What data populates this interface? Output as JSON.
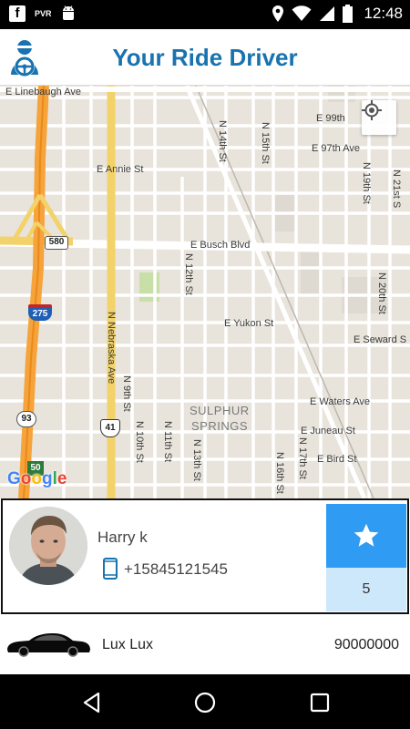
{
  "status_bar": {
    "left_icons": [
      "facebook-icon",
      "pvr-icon",
      "android-icon"
    ],
    "pvr_label": "PVR",
    "right_icons": [
      "location-icon",
      "wifi-icon",
      "signal-icon",
      "battery-icon"
    ],
    "time": "12:48"
  },
  "app_bar": {
    "title": "Your Ride Driver",
    "logo_icon": "driver-steering-wheel-icon",
    "brand_color": "#1873b0"
  },
  "map": {
    "labels": {
      "linebaugh": "E Linebaugh Ave",
      "e99": "E 99th",
      "e97": "E 97th Ave",
      "annie": "E Annie St",
      "busch": "E Busch Blvd",
      "yukon": "E Yukon St",
      "seward": "E Seward S",
      "waters": "E Waters Ave",
      "juneau": "E Juneau St",
      "bird": "E Bird St",
      "sulphur": "SULPHUR",
      "springs": "SPRINGS",
      "n14": "N 14th St",
      "n15": "N 15th St",
      "n19": "N 19th St",
      "n21": "N 21st S",
      "n12": "N 12th St",
      "n20": "N 20th St",
      "nebraska": "N Nebraska Ave",
      "n9": "N 9th St",
      "n10": "N 10th St",
      "n11": "N 11th St",
      "n13": "N 13th St",
      "n17": "N 17th St",
      "n16": "N 16th St",
      "shield_580": "580",
      "shield_275": "275",
      "shield_93": "93",
      "shield_41": "41",
      "shield_50": "50"
    },
    "google": {
      "letters": [
        "G",
        "o",
        "o",
        "g",
        "l",
        "e"
      ],
      "colors": [
        "#4285f4",
        "#ea4335",
        "#fbbc05",
        "#4285f4",
        "#34a853",
        "#ea4335"
      ]
    },
    "locate_icon": "my-location-icon"
  },
  "driver": {
    "name": "Harry k",
    "phone": "+15845121545",
    "phone_icon": "mobile-phone-icon",
    "rating": "5",
    "rating_icon": "star-icon",
    "rating_color": "#2f9bf2"
  },
  "car": {
    "icon": "car-icon",
    "name": "Lux Lux",
    "plate": "90000000"
  },
  "nav_bar": {
    "icons": [
      "back-icon",
      "home-icon",
      "recents-icon"
    ]
  }
}
